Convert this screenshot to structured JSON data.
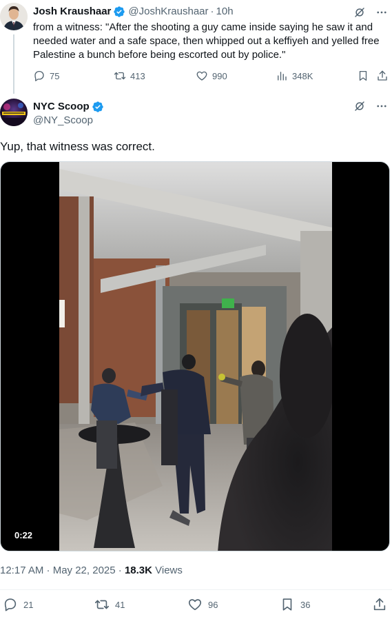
{
  "reply_tweet": {
    "author_name": "Josh Kraushaar",
    "author_handle": "@JoshKraushaar",
    "separator": "·",
    "time": "10h",
    "text": "from a witness: \"After the shooting a guy came inside saying he saw it and needed water and a safe space, then whipped out a keffiyeh and yelled free Palestine a bunch before being escorted out by police.\"",
    "stats": {
      "replies": "75",
      "reposts": "413",
      "likes": "990",
      "views": "348K"
    }
  },
  "main_tweet": {
    "author_name": "NYC Scoop",
    "author_handle": "@NY_Scoop",
    "text": "Yup, that witness was correct.",
    "video_duration": "0:22",
    "timestamp": "12:17 AM · May 22, 2025 · ",
    "views_count": "18.3K",
    "views_label": " Views",
    "stats": {
      "replies": "21",
      "reposts": "41",
      "likes": "96",
      "bookmarks": "36"
    }
  },
  "colors": {
    "text": "#0f1419",
    "secondary": "#536471",
    "verified": "#1d9bf0",
    "divider": "#eff3f4"
  },
  "icons": [
    "grok-icon",
    "more-icon",
    "reply-icon",
    "repost-icon",
    "like-icon",
    "views-icon",
    "bookmark-icon",
    "share-icon",
    "verified-badge-icon"
  ]
}
